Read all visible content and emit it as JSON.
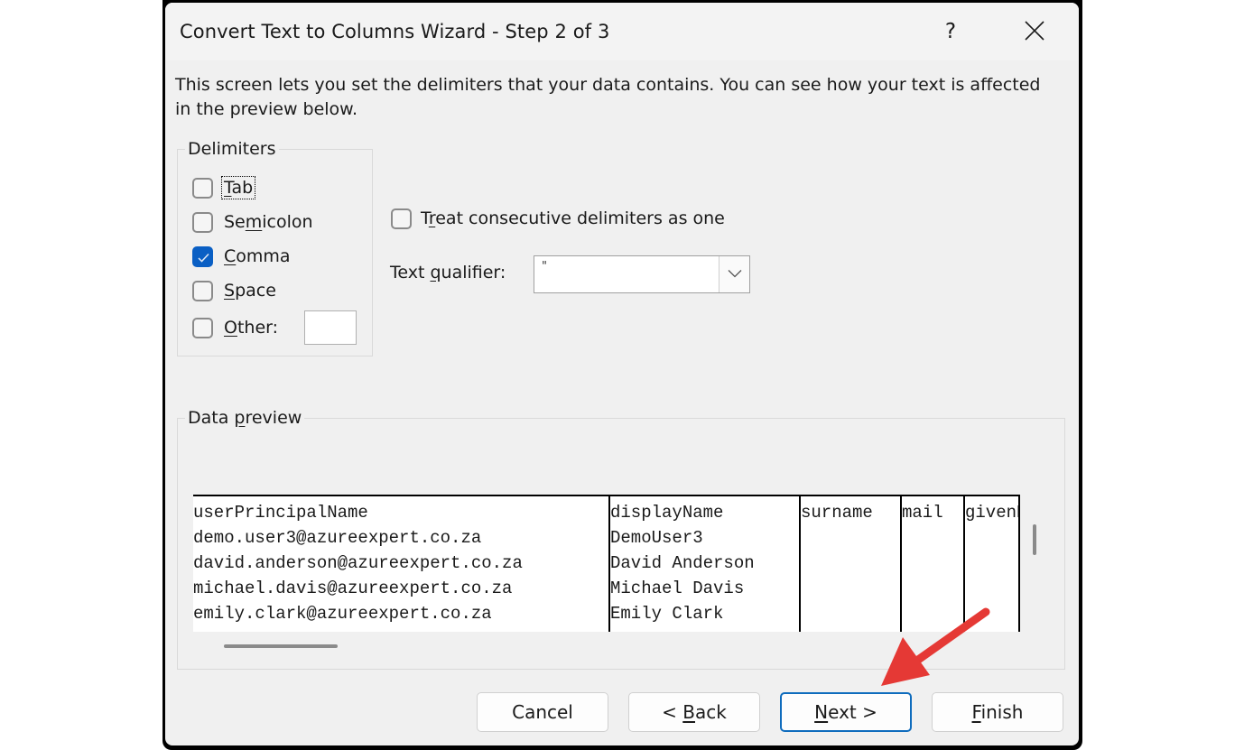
{
  "window": {
    "title": "Convert Text to Columns Wizard - Step 2 of 3",
    "help_label": "?",
    "close_icon": "close-icon"
  },
  "description": "This screen lets you set the delimiters that your data contains. You can see how your text is affected in the preview below.",
  "delimiters": {
    "group_label": "Delimiters",
    "items": [
      {
        "key": "T",
        "rest": "ab",
        "prefix": "",
        "checked": false,
        "label": "Tab"
      },
      {
        "key": "m",
        "prefix": "Se",
        "rest": "icolon",
        "checked": false,
        "label": "Semicolon"
      },
      {
        "key": "C",
        "prefix": "",
        "rest": "omma",
        "checked": true,
        "label": "Comma"
      },
      {
        "key": "S",
        "prefix": "",
        "rest": "pace",
        "checked": false,
        "label": "Space"
      },
      {
        "key": "O",
        "prefix": "",
        "rest": "ther:",
        "checked": false,
        "label": "Other:"
      }
    ],
    "other_value": ""
  },
  "options": {
    "consecutive": {
      "prefix": "T",
      "key": "r",
      "rest": "eat consecutive delimiters as one",
      "checked": false
    },
    "text_qualifier": {
      "prefix": "Text ",
      "key": "q",
      "rest": "ualifier:",
      "value": "\""
    }
  },
  "preview": {
    "group_label_prefix": "Data ",
    "group_label_key": "p",
    "group_label_rest": "review",
    "columns": [
      {
        "lines": [
          "userPrincipalName",
          "demo.user3@azureexpert.co.za",
          "david.anderson@azureexpert.co.za",
          "michael.davis@azureexpert.co.za",
          "emily.clark@azureexpert.co.za"
        ]
      },
      {
        "lines": [
          "displayName",
          "DemoUser3",
          "David Anderson",
          "Michael Davis",
          "Emily Clark"
        ]
      },
      {
        "lines": [
          "surname",
          "",
          "",
          "",
          ""
        ]
      },
      {
        "lines": [
          "mail",
          "",
          "",
          "",
          ""
        ]
      },
      {
        "lines": [
          "givenName",
          "",
          "",
          "",
          ""
        ]
      }
    ]
  },
  "buttons": {
    "cancel": "Cancel",
    "back_prefix": "< ",
    "back_key": "B",
    "back_rest": "ack",
    "next_key": "N",
    "next_rest": "ext >",
    "finish_key": "F",
    "finish_rest": "inish"
  },
  "colors": {
    "accent": "#0a5fc4",
    "default_button_border": "#0f6cbd",
    "annotation_arrow": "#e53935"
  }
}
